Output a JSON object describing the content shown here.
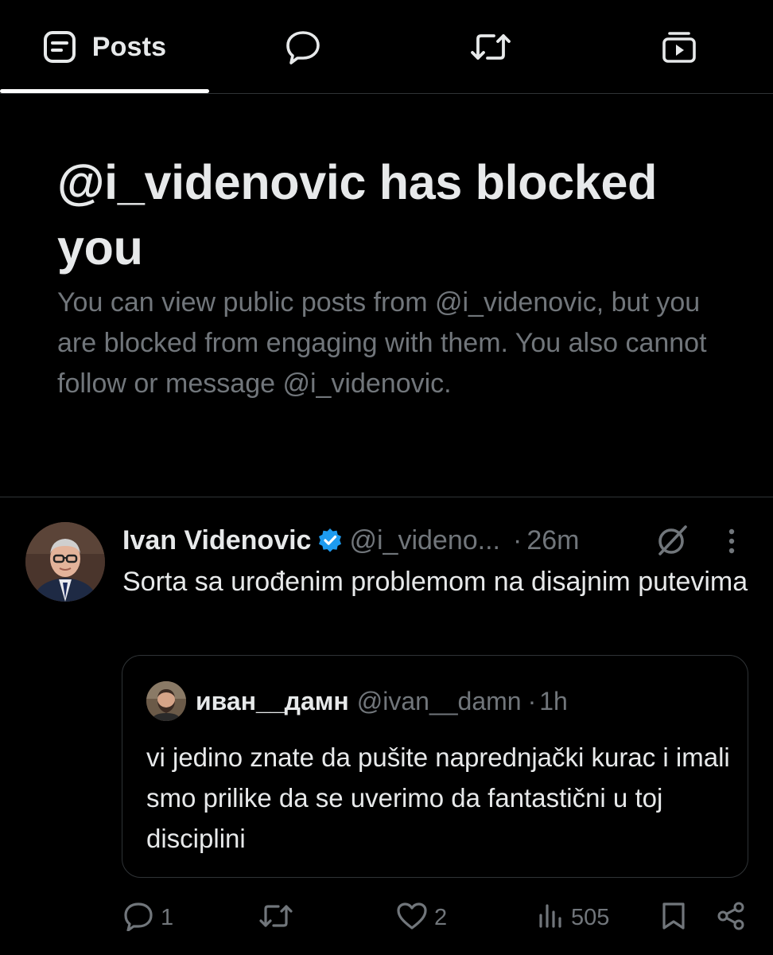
{
  "tabs": [
    {
      "label": "Posts",
      "icon": "posts-icon",
      "selected": true
    },
    {
      "label": "",
      "icon": "replies-icon",
      "selected": false
    },
    {
      "label": "",
      "icon": "reposts-icon",
      "selected": false
    },
    {
      "label": "",
      "icon": "media-icon",
      "selected": false
    }
  ],
  "blocked": {
    "title": "@i_videnovic has blocked you",
    "description": "You can view public posts from @i_videnovic, but you are blocked from engaging with them. You also cannot follow or message @i_videnovic."
  },
  "tweet": {
    "author_name": "Ivan Videnovic",
    "author_handle": "@i_videno...",
    "separator": "·",
    "time": "26m",
    "text": "Sorta sa urođenim problemom na disajnim putevima",
    "verified_color": "#1d9bf0",
    "quote": {
      "author_name": "иван__дамн",
      "author_handle": "@ivan__damn",
      "separator": "·",
      "time": "1h",
      "text": "vi jedino znate da pušite naprednjački kurac i imali smo prilike da se uverimo da fantastični u toj disciplini"
    },
    "actions": {
      "replies": "1",
      "reposts": "",
      "likes": "2",
      "views": "505"
    }
  },
  "colors": {
    "background": "#000000",
    "text_primary": "#e7e9ea",
    "text_secondary": "#71767b",
    "border": "#2f3336",
    "accent": "#1d9bf0"
  }
}
